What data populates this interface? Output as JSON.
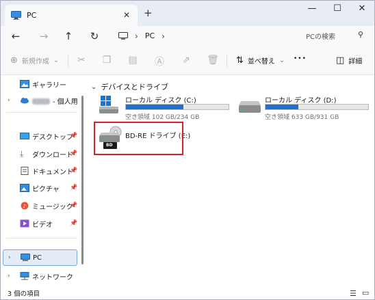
{
  "tab": {
    "title": "PC",
    "close": "✕"
  },
  "window_controls": {
    "new_tab": "+",
    "minimize": "—",
    "maximize": "☐",
    "close": "✕"
  },
  "nav": {
    "back": "←",
    "forward": "→",
    "up": "↑",
    "refresh": "↻"
  },
  "address": {
    "root_sep": "›",
    "crumb": "PC",
    "crumb_sep": "›"
  },
  "search": {
    "placeholder": "PCの検索"
  },
  "toolbar": {
    "new_label": "新規作成",
    "new_arrow": "⌄",
    "sort_label": "並べ替え",
    "sort_arrow": "⌄",
    "more": "•••",
    "details_label": "詳細"
  },
  "sidebar": {
    "items": [
      {
        "label": "ギャラリー"
      },
      {
        "label": "- 個人用"
      },
      {
        "label": "デスクトップ"
      },
      {
        "label": "ダウンロード"
      },
      {
        "label": "ドキュメント"
      },
      {
        "label": "ピクチャ"
      },
      {
        "label": "ミュージック"
      },
      {
        "label": "ビデオ"
      },
      {
        "label": "PC"
      },
      {
        "label": "ネットワーク"
      }
    ]
  },
  "content": {
    "group_title": "デバイスとドライブ",
    "drives": [
      {
        "name": "ローカル ディスク (C:)",
        "free_text": "空き領域 102 GB/234 GB",
        "used_fraction": 0.56
      },
      {
        "name": "ローカル ディスク (D:)",
        "free_text": "空き領域 633 GB/931 GB",
        "used_fraction": 0.32
      },
      {
        "name": "BD-RE ドライブ (E:)",
        "badge": "BD"
      }
    ]
  },
  "status": {
    "count": "3 個の項目"
  },
  "colors": {
    "accent": "#1e72c9",
    "highlight": "#d6202a",
    "tabbar": "#e8edf4"
  }
}
